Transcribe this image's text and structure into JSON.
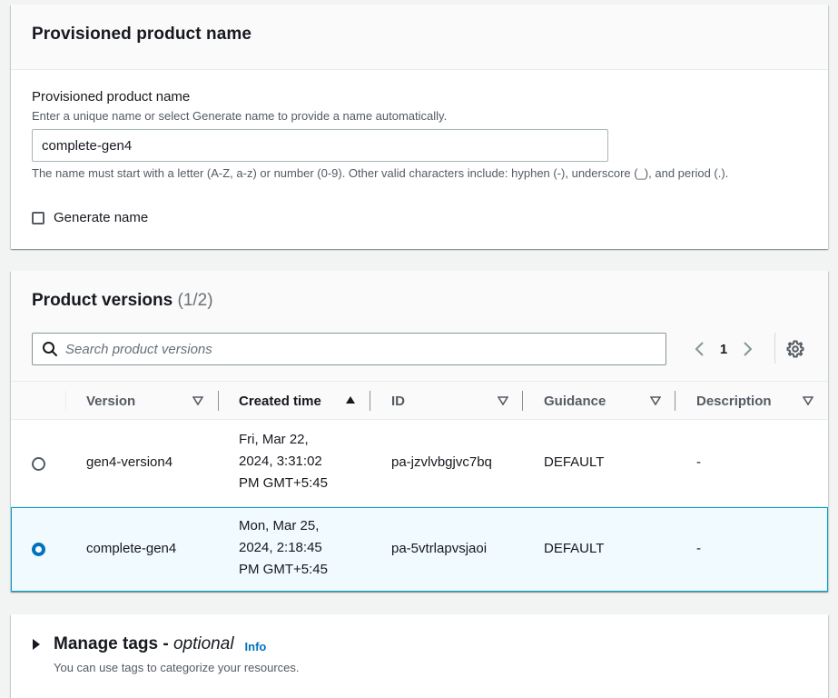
{
  "name_panel": {
    "title": "Provisioned product name",
    "field_label": "Provisioned product name",
    "field_description": "Enter a unique name or select Generate name to provide a name automatically.",
    "input_value": "complete-gen4",
    "constraint_text": "The name must start with a letter (A-Z, a-z) or number (0-9). Other valid characters include: hyphen (-), underscore (_), and period (.).",
    "checkbox_label": "Generate name",
    "checkbox_checked": false
  },
  "versions_panel": {
    "title": "Product versions",
    "count": "(1/2)",
    "search_placeholder": "Search product versions",
    "page_number": "1",
    "columns": [
      {
        "label": "Version",
        "sort": "filter"
      },
      {
        "label": "Created time",
        "sort": "ascending"
      },
      {
        "label": "ID",
        "sort": "filter"
      },
      {
        "label": "Guidance",
        "sort": "filter"
      },
      {
        "label": "Description",
        "sort": "filter"
      }
    ],
    "rows": [
      {
        "selected": false,
        "version": "gen4-version4",
        "created_line1": "Fri, Mar 22,",
        "created_line2": "2024, 3:31:02",
        "created_line3": "PM GMT+5:45",
        "id": "pa-jzvlvbgjvc7bq",
        "guidance": "DEFAULT",
        "description": "-"
      },
      {
        "selected": true,
        "version": "complete-gen4",
        "created_line1": "Mon, Mar 25,",
        "created_line2": "2024, 2:18:45",
        "created_line3": "PM GMT+5:45",
        "id": "pa-5vtrlapvsjaoi",
        "guidance": "DEFAULT",
        "description": "-"
      }
    ]
  },
  "tags_panel": {
    "title": "Manage tags - ",
    "title_optional": "optional",
    "info_label": "Info",
    "description": "You can use tags to categorize your resources."
  },
  "colors": {
    "accent": "#0073bb",
    "selected_row_bg": "#f1faff",
    "selected_row_border": "#00a1c9"
  }
}
